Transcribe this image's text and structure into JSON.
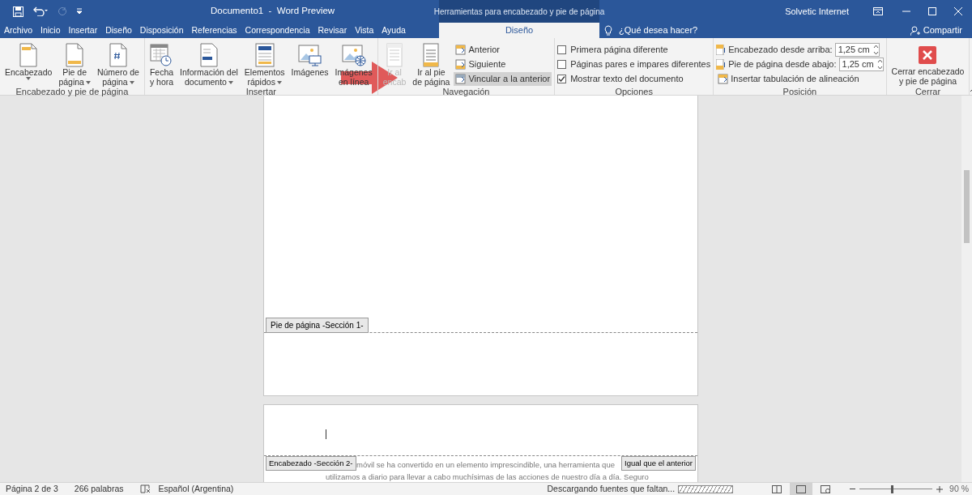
{
  "title_bar": {
    "title": "Documento1  -  Word Preview",
    "context_group": "Herramientas para encabezado y pie de página",
    "user": "Solvetic Internet"
  },
  "tabs": [
    {
      "label": "Archivo",
      "selected": false,
      "kind": "normal"
    },
    {
      "label": "Inicio",
      "selected": false,
      "kind": "normal"
    },
    {
      "label": "Insertar",
      "selected": false,
      "kind": "normal"
    },
    {
      "label": "Diseño",
      "selected": false,
      "kind": "normal"
    },
    {
      "label": "Disposición",
      "selected": false,
      "kind": "normal"
    },
    {
      "label": "Referencias",
      "selected": false,
      "kind": "normal"
    },
    {
      "label": "Correspondencia",
      "selected": false,
      "kind": "normal"
    },
    {
      "label": "Revisar",
      "selected": false,
      "kind": "normal"
    },
    {
      "label": "Vista",
      "selected": false,
      "kind": "normal"
    },
    {
      "label": "Ayuda",
      "selected": false,
      "kind": "normal"
    },
    {
      "label": "Diseño",
      "selected": true,
      "kind": "context"
    }
  ],
  "tell_me": {
    "placeholder": "¿Qué desea hacer?"
  },
  "share": "Compartir",
  "ribbon": {
    "groups": [
      {
        "label": "Encabezado y pie de página",
        "items": [
          {
            "kind": "large",
            "lines": [
              "Encabezado"
            ],
            "dropdown": true,
            "disabled": false
          },
          {
            "kind": "large",
            "lines": [
              "Pie de",
              "página"
            ],
            "dropdown": true,
            "disabled": false
          },
          {
            "kind": "large",
            "lines": [
              "Número de",
              "página"
            ],
            "dropdown": true,
            "disabled": false
          }
        ]
      },
      {
        "label": "Insertar",
        "items": [
          {
            "kind": "large",
            "lines": [
              "Fecha",
              "y hora"
            ],
            "dropdown": false,
            "disabled": false
          },
          {
            "kind": "large",
            "lines": [
              "Información del",
              "documento"
            ],
            "dropdown": true,
            "disabled": false
          },
          {
            "kind": "large",
            "lines": [
              "Elementos",
              "rápidos"
            ],
            "dropdown": true,
            "disabled": false
          },
          {
            "kind": "large",
            "lines": [
              "Imágenes"
            ],
            "dropdown": false,
            "disabled": false
          },
          {
            "kind": "large",
            "lines": [
              "Imágenes",
              "en línea"
            ],
            "dropdown": false,
            "disabled": false
          }
        ]
      },
      {
        "label": "Navegación",
        "items": [
          {
            "kind": "large",
            "lines": [
              "Ir al",
              "encab"
            ],
            "dropdown": false,
            "disabled": true
          },
          {
            "kind": "large",
            "lines": [
              "Ir al pie",
              "de página"
            ],
            "dropdown": false,
            "disabled": false
          },
          {
            "kind": "small",
            "label": "Anterior",
            "on": false
          },
          {
            "kind": "small",
            "label": "Siguiente",
            "on": false
          },
          {
            "kind": "small",
            "label": "Vincular a la anterior",
            "on": true
          }
        ]
      },
      {
        "label": "Opciones",
        "items": [
          {
            "kind": "checkbox",
            "label": "Primera página diferente",
            "checked": false
          },
          {
            "kind": "checkbox",
            "label": "Páginas pares e impares diferentes",
            "checked": false
          },
          {
            "kind": "checkbox",
            "label": "Mostrar texto del documento",
            "checked": true
          }
        ]
      },
      {
        "label": "Posición",
        "items": [
          {
            "kind": "spinner",
            "label": "Encabezado desde arriba:",
            "value": "1,25 cm"
          },
          {
            "kind": "spinner",
            "label": "Pie de página desde abajo:",
            "value": "1,25 cm"
          },
          {
            "kind": "small",
            "label": "Insertar tabulación de alineación",
            "on": false
          }
        ]
      },
      {
        "label": "Cerrar",
        "items": [
          {
            "kind": "large",
            "lines": [
              "Cerrar encabezado",
              "y pie de página"
            ],
            "dropdown": false,
            "disabled": false
          }
        ]
      }
    ]
  },
  "document": {
    "footer_tag": "Pie de página -Sección 1-",
    "header_tag": "Encabezado -Sección 2-",
    "link_tag": "Igual que el anterior",
    "body_lines": [
      "móvil se ha convertido en un elemento imprescindible, una herramienta que",
      "utilizamos a diario para llevar a cabo muchísimas de las acciones de nuestro día a día. Seguro"
    ]
  },
  "status_bar": {
    "page": "Página 2 de 3",
    "words": "266 palabras",
    "language": "Español (Argentina)",
    "download": {
      "text": "Descargando fuentes que faltan...",
      "level": 1
    },
    "views": [
      {
        "selected": false
      },
      {
        "selected": true
      },
      {
        "selected": false
      }
    ],
    "zoom": {
      "level": 0.45,
      "reading": "90 %"
    }
  }
}
